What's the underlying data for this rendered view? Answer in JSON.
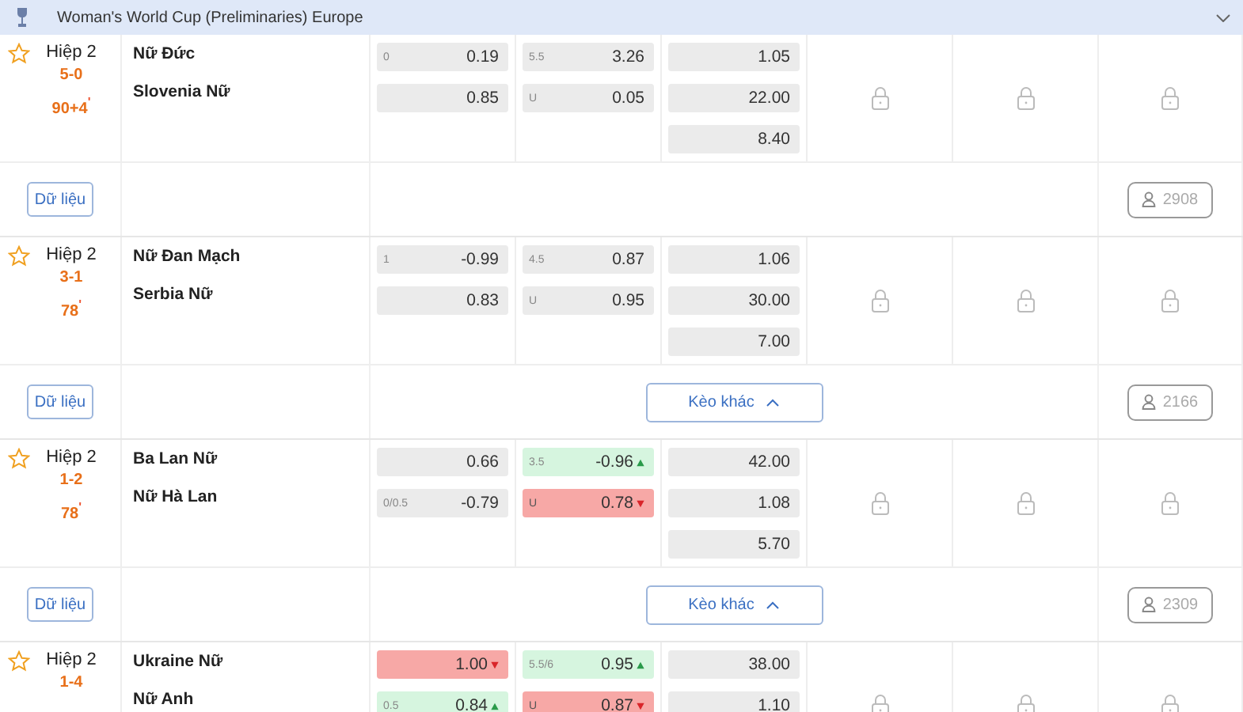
{
  "league": {
    "title": "Woman's World Cup (Preliminaries) Europe"
  },
  "matches": [
    {
      "favorite": false,
      "period": "Hiệp 2",
      "score": "5-0",
      "minute": "90+4$^{'}$",
      "home": "Nữ Đức",
      "away": "Slovenia Nữ",
      "handicap": [
        {
          "line": "0",
          "odds": "0.19",
          "rising": false,
          "falling": false
        },
        {
          "odds": "0.85",
          "rising": false,
          "falling": false
        }
      ],
      "over_under": [
        {
          "line": "5.5",
          "odds": "3.26",
          "rising": false,
          "falling": false
        },
        {
          "line": "U",
          "odds": "0.05",
          "rising": false,
          "falling": false
        }
      ],
      "result": [
        {
          "odds": "1.05",
          "rising": false,
          "falling": false
        },
        {
          "odds": "22.00",
          "rising": false,
          "falling": false
        },
        {
          "odds": "8.40",
          "rising": false,
          "falling": false
        }
      ],
      "locked": [
        true,
        true,
        true
      ],
      "data_button": "Dữ liệu",
      "viewers": "2908"
    },
    {
      "favorite": false,
      "period": "Hiệp 2",
      "score": "3-1",
      "minute": "78$^{'}$",
      "home": "Nữ Đan Mạch",
      "away": "Serbia Nữ",
      "handicap": [
        {
          "line": "1",
          "odds": "-0.99",
          "rising": false,
          "falling": false
        },
        {
          "odds": "0.83",
          "rising": false,
          "falling": false
        }
      ],
      "over_under": [
        {
          "line": "4.5",
          "odds": "0.87",
          "rising": false,
          "falling": false
        },
        {
          "line": "U",
          "odds": "0.95",
          "rising": false,
          "falling": false
        }
      ],
      "result": [
        {
          "odds": "1.06",
          "rising": false,
          "falling": false
        },
        {
          "odds": "30.00",
          "rising": false,
          "falling": false
        },
        {
          "odds": "7.00",
          "rising": false,
          "falling": false
        }
      ],
      "locked": [
        true,
        true,
        true
      ],
      "data_button": "Dữ liệu",
      "more_button": "Kèo khác",
      "viewers": "2166"
    },
    {
      "favorite": false,
      "period": "Hiệp 2",
      "score": "1-2",
      "minute": "78$^{'}$",
      "home": "Ba Lan Nữ",
      "away": "Nữ Hà Lan",
      "handicap": [
        {
          "odds": "0.66",
          "rising": false,
          "falling": false
        },
        {
          "line": "0/0.5",
          "odds": "-0.79",
          "rising": false,
          "falling": false
        }
      ],
      "over_under": [
        {
          "line": "3.5",
          "odds": "-0.96",
          "rising": true,
          "falling": false
        },
        {
          "line": "U",
          "odds": "0.78",
          "rising": false,
          "falling": true
        }
      ],
      "result": [
        {
          "odds": "42.00",
          "rising": false,
          "falling": false
        },
        {
          "odds": "1.08",
          "rising": false,
          "falling": false
        },
        {
          "odds": "5.70",
          "rising": false,
          "falling": false
        }
      ],
      "locked": [
        true,
        true,
        true
      ],
      "data_button": "Dữ liệu",
      "more_button": "Kèo khác",
      "viewers": "2309"
    },
    {
      "favorite": false,
      "period": "Hiệp 2",
      "score": "1-4",
      "home": "Ukraine Nữ",
      "away": "Nữ Anh",
      "handicap": [
        {
          "odds": "1.00",
          "rising": false,
          "falling": true
        },
        {
          "line": "0.5",
          "odds": "0.84",
          "rising": true,
          "falling": false
        }
      ],
      "over_under": [
        {
          "line": "5.5/6",
          "odds": "0.95",
          "rising": true,
          "falling": false
        },
        {
          "line": "U",
          "odds": "0.87",
          "rising": false,
          "falling": true
        }
      ],
      "result": [
        {
          "odds": "38.00",
          "rising": false,
          "falling": false
        },
        {
          "odds": "1.10",
          "rising": false,
          "falling": false
        }
      ],
      "locked": [
        true,
        true,
        true
      ]
    }
  ]
}
